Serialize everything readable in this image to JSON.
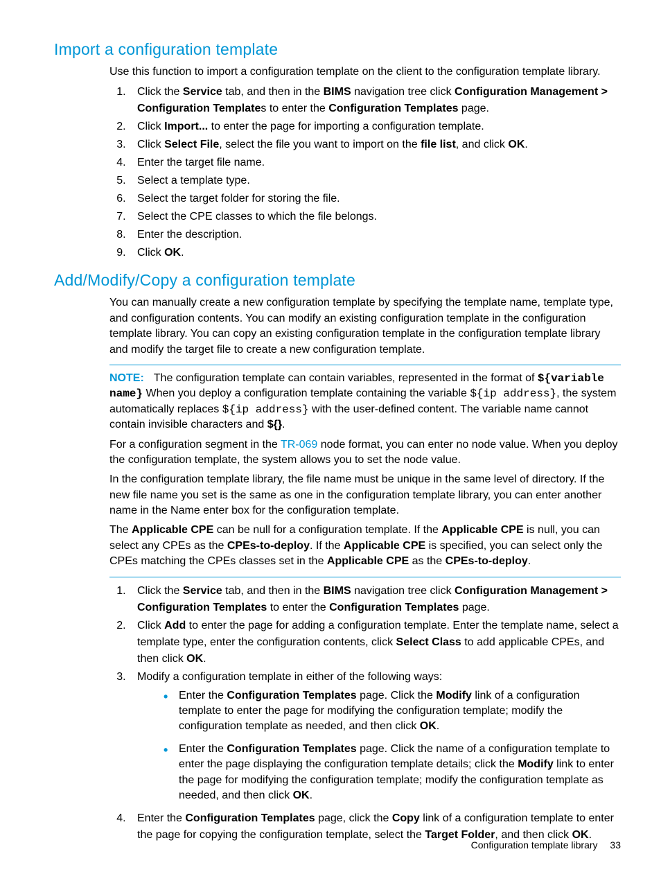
{
  "section1": {
    "heading": "Import a configuration template",
    "intro": "Use this function to import a configuration template on the client to the configuration template library.",
    "steps": {
      "s1a": "Click the ",
      "s1b": "Service",
      "s1c": " tab, and then in the ",
      "s1d": "BIMS",
      "s1e": " navigation tree click ",
      "s1f": "Configuration Management > Configuration Template",
      "s1g": "s to enter the ",
      "s1h": "Configuration Templates",
      "s1i": " page.",
      "s2a": "Click ",
      "s2b": "Import...",
      "s2c": " to enter the page for importing a configuration template.",
      "s3a": "Click ",
      "s3b": "Select File",
      "s3c": ", select the file you want to import on the ",
      "s3d": "file list",
      "s3e": ", and click ",
      "s3f": "OK",
      "s3g": ".",
      "s4": "Enter the target file name.",
      "s5": "Select a template type.",
      "s6": "Select the target folder for storing the file.",
      "s7": "Select the CPE classes to which the file belongs.",
      "s8": "Enter the description.",
      "s9a": "Click ",
      "s9b": "OK",
      "s9c": "."
    }
  },
  "section2": {
    "heading": "Add/Modify/Copy a configuration template",
    "intro": "You can manually create a new configuration template by specifying the template name, template type, and configuration contents. You can modify an existing configuration template in the configuration template library. You can copy an existing configuration template in the configuration template library and modify the target file to create a new configuration template.",
    "note": {
      "label": "NOTE:",
      "p1a": "The configuration template can contain variables, represented in the format of ",
      "p1b": "${variable name}",
      "p1c": " When you deploy a configuration template containing the variable ",
      "p1d": "${ip address}",
      "p1e": ", the system automatically replaces ",
      "p1f": "${ip address}",
      "p1g": " with the user-defined content. The variable name cannot contain invisible characters and ",
      "p1h": "${}",
      "p1i": "."
    },
    "p2a": "For a configuration segment in the ",
    "p2b": "TR-069",
    "p2c": " node format, you can enter no node value. When you deploy the configuration template, the system allows you to set the node value.",
    "p3": "In the configuration template library, the file name must be unique in the same level of directory. If the new file name you set is the same as one in the configuration template library, you can enter another name in the Name enter box for the configuration template.",
    "p4a": "The ",
    "p4b": "Applicable CPE",
    "p4c": " can be null for a configuration template. If the ",
    "p4d": "Applicable CPE",
    "p4e": " is null, you can select any CPEs as the ",
    "p4f": "CPEs-to-deploy",
    "p4g": ". If the ",
    "p4h": "Applicable CPE",
    "p4i": " is specified, you can select only the CPEs matching the CPEs classes set in the ",
    "p4j": "Applicable CPE",
    "p4k": " as the ",
    "p4l": "CPEs-to-deploy",
    "p4m": ".",
    "steps": {
      "s1a": "Click the ",
      "s1b": "Service",
      "s1c": " tab, and then in the ",
      "s1d": "BIMS",
      "s1e": " navigation tree click ",
      "s1f": "Configuration Management > Configuration Templates",
      "s1g": " to enter the ",
      "s1h": "Configuration Templates",
      "s1i": " page.",
      "s2a": "Click ",
      "s2b": "Add",
      "s2c": " to enter the page for adding a configuration template. Enter the template name, select a template type, enter the configuration contents, click ",
      "s2d": "Select Class",
      "s2e": " to add applicable CPEs, and then click ",
      "s2f": "OK",
      "s2g": ".",
      "s3": "Modify a configuration template in either of the following ways:",
      "b1a": "Enter the ",
      "b1b": "Configuration Templates",
      "b1c": " page. Click the ",
      "b1d": "Modify",
      "b1e": " link of a configuration template to enter the page for modifying the configuration template; modify the configuration template as needed, and then click ",
      "b1f": "OK",
      "b1g": ".",
      "b2a": "Enter the ",
      "b2b": "Configuration Templates",
      "b2c": " page. Click the name of a configuration template to enter the page displaying the configuration template details; click the ",
      "b2d": "Modify",
      "b2e": " link to enter the page for modifying the configuration template; modify the configuration template as needed, and then click ",
      "b2f": "OK",
      "b2g": ".",
      "s4a": "Enter the ",
      "s4b": "Configuration Templates",
      "s4c": " page, click the ",
      "s4d": "Copy",
      "s4e": " link of a configuration template to enter the page for copying the configuration template, select the ",
      "s4f": "Target Folder",
      "s4g": ", and then click ",
      "s4h": "OK",
      "s4i": "."
    }
  },
  "footer": {
    "title": "Configuration template library",
    "page": "33"
  }
}
